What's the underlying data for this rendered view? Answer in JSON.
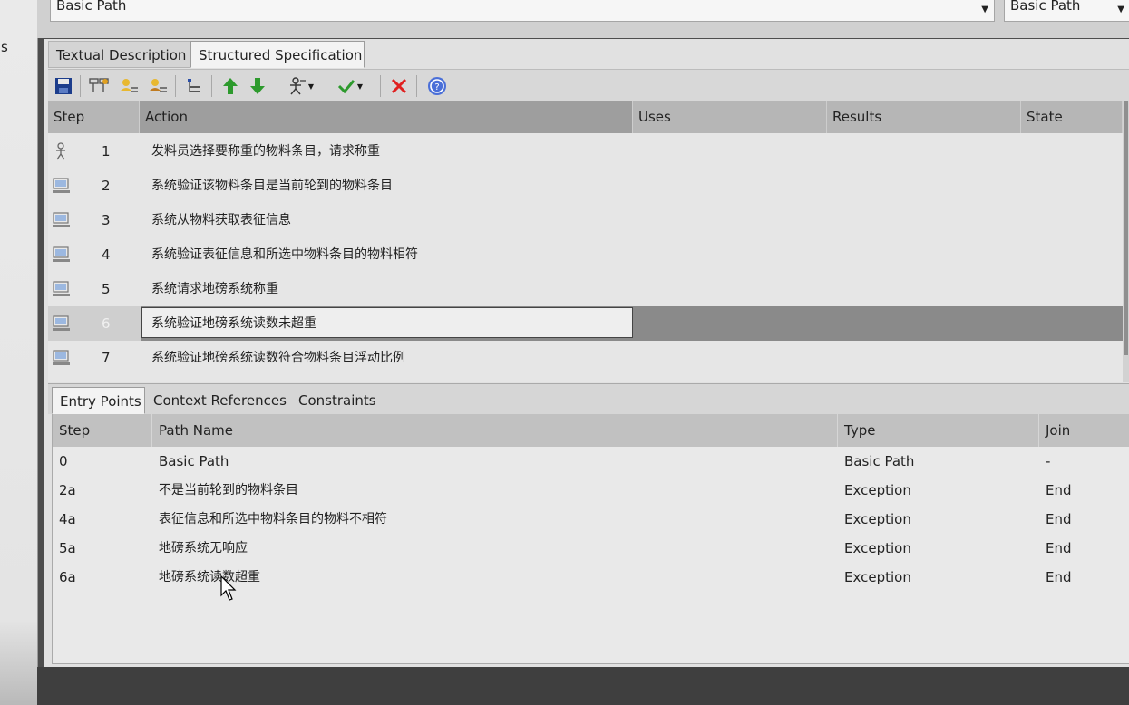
{
  "left_strip": {
    "text": "s"
  },
  "top": {
    "path_combo": "Basic Path",
    "path_combo_right": "Basic Path"
  },
  "tabs_top": [
    {
      "label": "Textual Description",
      "active": false
    },
    {
      "label": "Structured Specification",
      "active": true
    }
  ],
  "toolbar": {
    "icons": [
      "save-icon",
      "new-step-icon",
      "add-actor-step-icon",
      "add-system-step-icon",
      "hierarchy-icon",
      "move-up-icon",
      "move-down-icon",
      "actor-toggle-icon",
      "validate-icon",
      "delete-icon",
      "help-icon"
    ]
  },
  "steps_table": {
    "columns": [
      "Step",
      "Action",
      "Uses",
      "Results",
      "State"
    ],
    "rows": [
      {
        "icon": "actor-icon",
        "step": "1",
        "action": "发料员选择要称重的物料条目，请求称重"
      },
      {
        "icon": "system-icon",
        "step": "2",
        "action": "系统验证该物料条目是当前轮到的物料条目"
      },
      {
        "icon": "system-icon",
        "step": "3",
        "action": "系统从物料获取表征信息"
      },
      {
        "icon": "system-icon",
        "step": "4",
        "action": "系统验证表征信息和所选中物料条目的物料相符"
      },
      {
        "icon": "system-icon",
        "step": "5",
        "action": "系统请求地磅系统称重"
      },
      {
        "icon": "system-icon",
        "step": "6",
        "action": "系统验证地磅系统读数未超重",
        "selected": true
      },
      {
        "icon": "system-icon",
        "step": "7",
        "action": "系统验证地磅系统读数符合物料条目浮动比例"
      }
    ]
  },
  "tabs_bottom": [
    {
      "label": "Entry Points",
      "active": true
    },
    {
      "label": "Context References",
      "active": false
    },
    {
      "label": "Constraints",
      "active": false
    }
  ],
  "entry_points": {
    "columns": [
      "Step",
      "Path Name",
      "Type",
      "Join"
    ],
    "rows": [
      {
        "step": "0",
        "path_name": "Basic Path",
        "type": "Basic Path",
        "join": "-"
      },
      {
        "step": "2a",
        "path_name": "不是当前轮到的物料条目",
        "type": "Exception",
        "join": "End"
      },
      {
        "step": "4a",
        "path_name": "表征信息和所选中物料条目的物料不相符",
        "type": "Exception",
        "join": "End"
      },
      {
        "step": "5a",
        "path_name": "地磅系统无响应",
        "type": "Exception",
        "join": "End"
      },
      {
        "step": "6a",
        "path_name": "地磅系统读数超重",
        "type": "Exception",
        "join": "End"
      }
    ]
  },
  "colors": {
    "delete": "#e02020",
    "arrow_green": "#2d9a2d",
    "help": "#3355cc",
    "selected_row": "#8a8a8a"
  }
}
